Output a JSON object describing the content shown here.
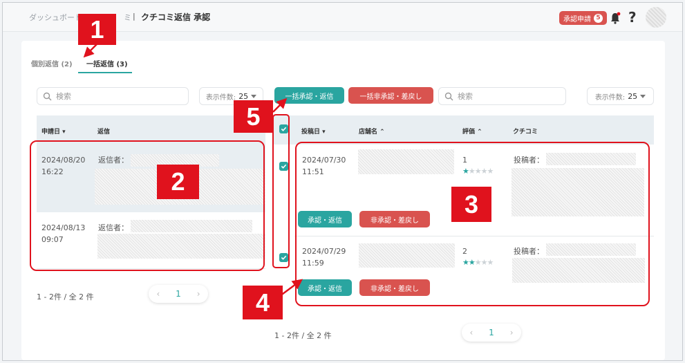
{
  "breadcrumb": {
    "dashboard": "ダッシュボード",
    "partial": "ミ",
    "sep": "|",
    "title": "クチコミ返信 承認"
  },
  "header": {
    "request_label": "承認申請",
    "request_count": "5",
    "help": "?"
  },
  "tabs": [
    {
      "label": "個別返信 (2)"
    },
    {
      "label": "一括返信 (3)"
    }
  ],
  "left": {
    "search_placeholder": "検索",
    "perpage_label": "表示件数:",
    "perpage_value": "25",
    "columns": {
      "date": "申請日 ▾",
      "reply": "返信"
    },
    "rows": [
      {
        "date": "2024/08/20",
        "time": "16:22",
        "reply_label": "返信者："
      },
      {
        "date": "2024/08/13",
        "time": "09:07",
        "reply_label": "返信者："
      }
    ],
    "pager_label": "1 - 2件 / 全 2 件",
    "page": "1"
  },
  "bulk": {
    "approve": "一括承認・返信",
    "reject": "一括非承認・差戻し"
  },
  "right": {
    "search_placeholder": "検索",
    "perpage_label": "表示件数:",
    "perpage_value": "25",
    "columns": {
      "date": "投稿日 ▾",
      "store": "店舗名 ⌃",
      "rating": "評価 ⌃",
      "review": "クチコミ"
    },
    "rows": [
      {
        "date": "2024/07/30",
        "time": "11:51",
        "rating": 1,
        "poster_label": "投稿者："
      },
      {
        "date": "2024/07/29",
        "time": "11:59",
        "rating": 2,
        "poster_label": "投稿者："
      }
    ],
    "approve": "承認・返信",
    "reject": "非承認・差戻し",
    "pager_label": "1 - 2件 / 全 2 件",
    "page": "1"
  },
  "callouts": [
    "1",
    "2",
    "3",
    "4",
    "5"
  ],
  "colors": {
    "accent": "#2aa5a0",
    "danger": "#d9534f",
    "annotation": "#e0121d"
  },
  "icons": {
    "search": "search-icon",
    "bell": "bell-icon",
    "chevron": "chevron-down-icon",
    "check": "check-icon"
  }
}
